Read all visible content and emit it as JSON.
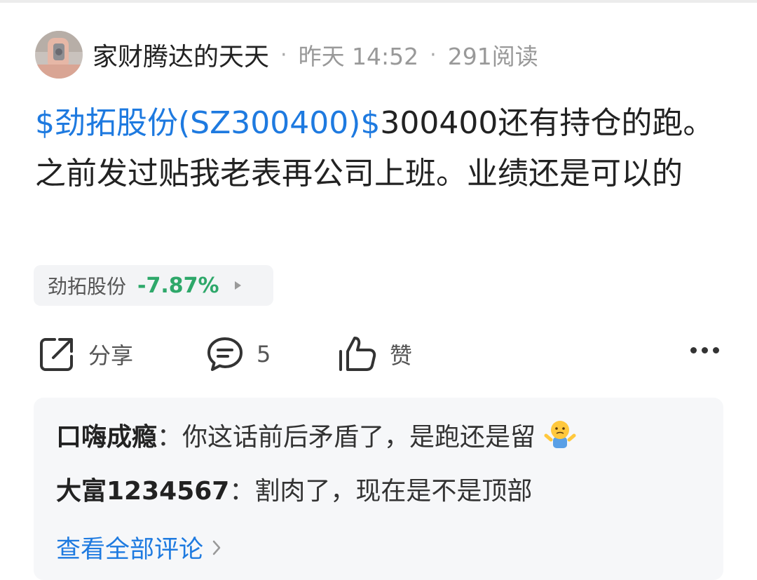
{
  "post": {
    "author": "家财腾达的天天",
    "separator": "·",
    "time": "昨天 14:52",
    "reads": "291阅读",
    "stock_link": "$劲拓股份(SZ300400)$",
    "body": "300400还有持仓的跑。之前发过贴我老表再公司上班。业绩还是可以的"
  },
  "stock_chip": {
    "name": "劲拓股份",
    "change": "-7.87%",
    "change_color": "#2ea86a"
  },
  "actions": {
    "share_label": "分享",
    "comment_count": "5",
    "like_label": "赞"
  },
  "comments": [
    {
      "name": "口嗨成瘾",
      "colon": "：",
      "text": "你这话前后矛盾了，是跑还是留",
      "emoji": "shrug-emoji"
    },
    {
      "name": "大富1234567",
      "colon": "：",
      "text": "割肉了，现在是不是顶部"
    }
  ],
  "view_all": "查看全部评论",
  "colors": {
    "link": "#1e7ae0",
    "text": "#222222",
    "meta": "#999999"
  }
}
